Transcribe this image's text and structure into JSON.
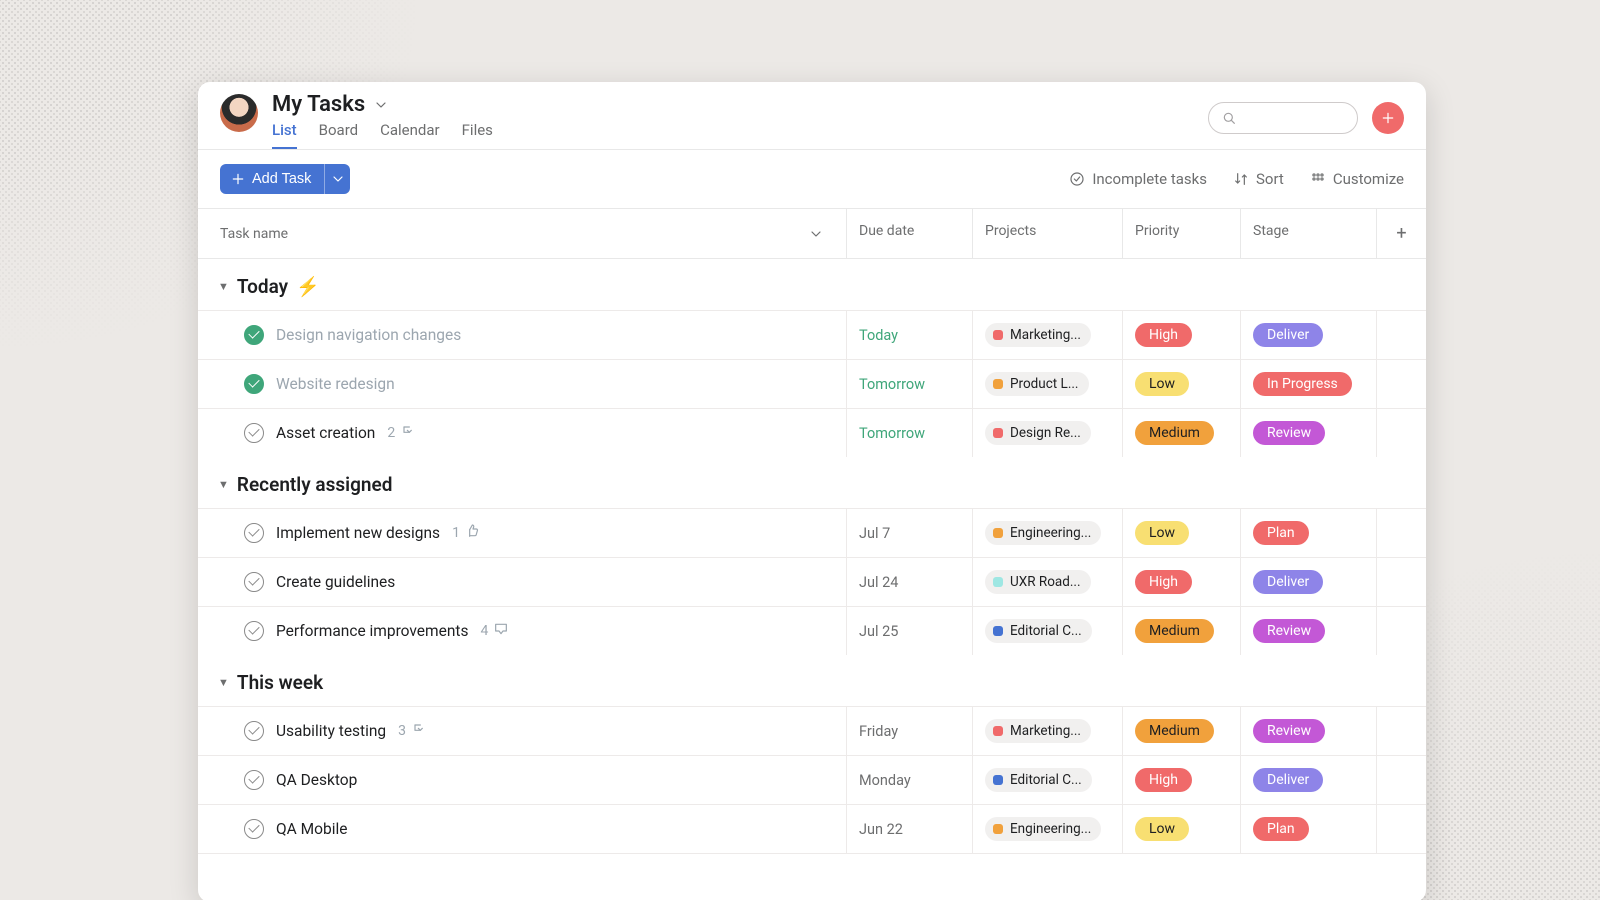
{
  "header": {
    "title": "My Tasks",
    "tabs": [
      "List",
      "Board",
      "Calendar",
      "Files"
    ],
    "active_tab_index": 0,
    "search_placeholder": ""
  },
  "toolbar": {
    "add_task_label": "Add Task",
    "filter_label": "Incomplete tasks",
    "sort_label": "Sort",
    "customize_label": "Customize"
  },
  "columns": {
    "task_name": "Task name",
    "due_date": "Due date",
    "projects": "Projects",
    "priority": "Priority",
    "stage": "Stage",
    "add": "+"
  },
  "priority_colors": {
    "High": "#f06a6a",
    "Medium": "#f1a13c",
    "Low": "#f8df72"
  },
  "priority_text": {
    "High": "light",
    "Medium": "dark",
    "Low": "dark"
  },
  "stage_colors": {
    "Deliver": "#8e84e8",
    "In Progress": "#f06a6a",
    "Review": "#c358d6",
    "Plan": "#f06a6a"
  },
  "project_dot_colors": {
    "Marketing...": "#f06a6a",
    "Product L...": "#f1a13c",
    "Design Re...": "#f06a6a",
    "Engineering...": "#f1a13c",
    "UXR Road...": "#9ee7e3",
    "Editorial C...": "#4573d2"
  },
  "sections": [
    {
      "title": "Today",
      "emoji": "⚡",
      "tasks": [
        {
          "done": true,
          "name": "Design navigation changes",
          "meta": null,
          "meta_icon": null,
          "due": "Today",
          "due_style": "green",
          "project": "Marketing...",
          "priority": "High",
          "stage": "Deliver"
        },
        {
          "done": true,
          "name": "Website redesign",
          "meta": null,
          "meta_icon": null,
          "due": "Tomorrow",
          "due_style": "green",
          "project": "Product L...",
          "priority": "Low",
          "stage": "In Progress"
        },
        {
          "done": false,
          "name": "Asset creation",
          "meta": "2",
          "meta_icon": "subtask",
          "due": "Tomorrow",
          "due_style": "green",
          "project": "Design Re...",
          "priority": "Medium",
          "stage": "Review"
        }
      ]
    },
    {
      "title": "Recently assigned",
      "emoji": null,
      "tasks": [
        {
          "done": false,
          "name": "Implement new designs",
          "meta": "1",
          "meta_icon": "like",
          "due": "Jul 7",
          "due_style": "plain",
          "project": "Engineering...",
          "priority": "Low",
          "stage": "Plan"
        },
        {
          "done": false,
          "name": "Create guidelines",
          "meta": null,
          "meta_icon": null,
          "due": "Jul 24",
          "due_style": "plain",
          "project": "UXR Road...",
          "priority": "High",
          "stage": "Deliver"
        },
        {
          "done": false,
          "name": "Performance improvements",
          "meta": "4",
          "meta_icon": "comment",
          "due": "Jul 25",
          "due_style": "plain",
          "project": "Editorial C...",
          "priority": "Medium",
          "stage": "Review"
        }
      ]
    },
    {
      "title": "This week",
      "emoji": null,
      "tasks": [
        {
          "done": false,
          "name": "Usability testing",
          "meta": "3",
          "meta_icon": "subtask",
          "due": "Friday",
          "due_style": "plain",
          "project": "Marketing...",
          "priority": "Medium",
          "stage": "Review"
        },
        {
          "done": false,
          "name": "QA Desktop",
          "meta": null,
          "meta_icon": null,
          "due": "Monday",
          "due_style": "plain",
          "project": "Editorial C...",
          "priority": "High",
          "stage": "Deliver"
        },
        {
          "done": false,
          "name": "QA Mobile",
          "meta": null,
          "meta_icon": null,
          "due": "Jun 22",
          "due_style": "plain",
          "project": "Engineering...",
          "priority": "Low",
          "stage": "Plan"
        }
      ]
    }
  ]
}
